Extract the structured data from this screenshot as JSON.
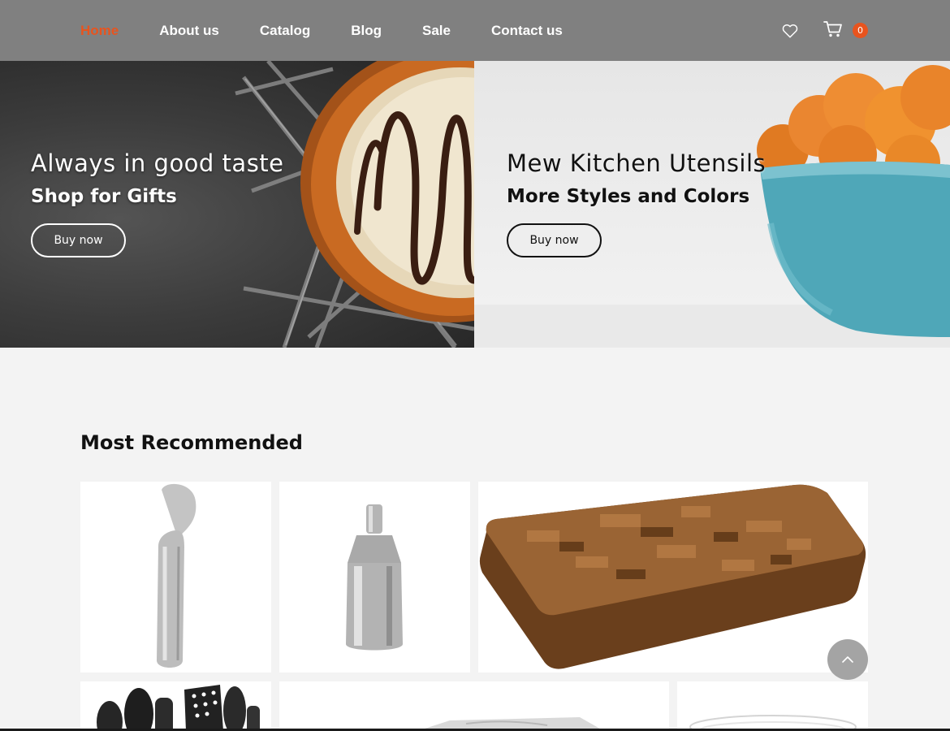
{
  "nav": {
    "items": [
      {
        "label": "Home",
        "active": true
      },
      {
        "label": "About us",
        "active": false
      },
      {
        "label": "Catalog",
        "active": false
      },
      {
        "label": "Blog",
        "active": false
      },
      {
        "label": "Sale",
        "active": false
      },
      {
        "label": "Contact us",
        "active": false
      }
    ],
    "wishlist_icon": "heart-icon",
    "cart_icon": "cart-icon",
    "cart_count": "0"
  },
  "banners": [
    {
      "title": "Always in good taste",
      "subtitle": "Shop for Gifts",
      "button": "Buy now"
    },
    {
      "title": "Mew Kitchen Utensils",
      "subtitle": "More Styles and Colors",
      "button": "Buy now"
    }
  ],
  "recommended": {
    "heading": "Most Recommended",
    "products": [
      "ice-cream-scoop",
      "cocktail-shaker",
      "cutting-board",
      "utensil-set",
      "marble-board",
      "glass-bowl"
    ]
  },
  "scroll_top_icon": "chevron-up-icon",
  "colors": {
    "accent": "#e8541e",
    "header": "#808080",
    "page": "#f3f3f3"
  }
}
